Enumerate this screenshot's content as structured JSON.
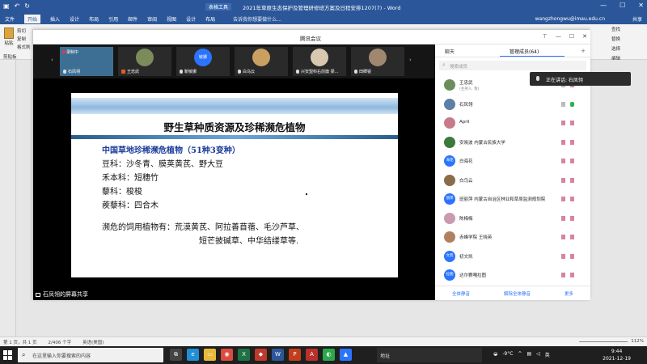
{
  "word": {
    "title_tools_tab": "表格工具",
    "doc_title": "2021年草原生态保护及管理研修班方案及日程安排1207(7) - Word",
    "tabs": [
      "文件",
      "开始",
      "插入",
      "设计",
      "布局",
      "引用",
      "邮件",
      "审阅",
      "视图",
      "设计",
      "布局"
    ],
    "active_tab": "开始",
    "tell_me": "告诉我你想要做什么...",
    "account": "wangzhongwu@imau.edu.cn",
    "share": "共享",
    "clipboard": {
      "paste": "粘贴",
      "cut": "剪切",
      "copy": "复制",
      "format": "格式刷",
      "group": "剪贴板"
    },
    "editing": {
      "find": "查找",
      "replace": "替换",
      "select": "选择",
      "group": "编辑"
    },
    "status": {
      "page": "第 1 页，共 1 页",
      "words": "2/406 个字",
      "lang": "英语(美国)",
      "zoom": "112%"
    }
  },
  "meeting": {
    "title": "腾讯会议",
    "recording_label": "录制中",
    "tiles": [
      {
        "name": "石凤翎",
        "mic": "on"
      },
      {
        "name": "王忠武",
        "mic": "off"
      },
      {
        "name": "靳敏娜",
        "mic": "on",
        "avatar": "敏娜"
      },
      {
        "name": "白乌云",
        "mic": "on"
      },
      {
        "name": "兴安盟科右前旗 梁...",
        "mic": "on"
      },
      {
        "name": "田卿锟",
        "mic": "on"
      }
    ],
    "share_label": "石凤翎的屏幕共享"
  },
  "slide": {
    "title": "野生草种质资源及珍稀濒危植物",
    "subtitle": "中国草地珍稀濒危植物（51种3变种）",
    "lines": [
      "豆科：沙冬青、膜荚黄芪、野大豆",
      "禾本科：短穗竹",
      "藜科：梭梭",
      "蒺藜科：四合木"
    ],
    "endangered_line1": "濒危的饲用植物有：荒漠黄芪、阿拉善苜蓿、毛沙芦草、",
    "endangered_line2": "短芒披碱草、中华结缕草等."
  },
  "panel": {
    "tab_chat": "聊天",
    "tab_members": "管理成员(64)",
    "search_placeholder": "搜索成员",
    "members": [
      {
        "name": "王忠武",
        "sub": "(主持人, 我)",
        "color": "#6b8e5a",
        "avatar": "",
        "cam": "on",
        "mic": "off"
      },
      {
        "name": "石凤翎",
        "sub": "",
        "color": "#5d7ea6",
        "avatar": "",
        "cam": "on",
        "mic": "on"
      },
      {
        "name": "April",
        "sub": "",
        "color": "#c77a8a",
        "avatar": "",
        "cam": "off",
        "mic": "off"
      },
      {
        "name": "安晓波 内蒙古民族大学",
        "sub": "",
        "color": "#3a7a3a",
        "avatar": "",
        "cam": "off",
        "mic": "off"
      },
      {
        "name": "白海花",
        "sub": "",
        "color": "#2b74ff",
        "avatar": "海花",
        "cam": "off",
        "mic": "off"
      },
      {
        "name": "白乌云",
        "sub": "",
        "color": "#8a6b4a",
        "avatar": "",
        "cam": "off",
        "mic": "off"
      },
      {
        "name": "班丽萍 内蒙古自治区林业和草原监测规划院",
        "sub": "",
        "color": "#2b74ff",
        "avatar": "丽萍",
        "cam": "off",
        "mic": "off"
      },
      {
        "name": "陈梅梅",
        "sub": "",
        "color": "#c99ab0",
        "avatar": "",
        "cam": "off",
        "mic": "off"
      },
      {
        "name": "赤峰学院 王晓英",
        "sub": "",
        "color": "#b08060",
        "avatar": "",
        "cam": "off",
        "mic": "off"
      },
      {
        "name": "初文凯",
        "sub": "",
        "color": "#2b74ff",
        "avatar": "文凯",
        "cam": "off",
        "mic": "off"
      },
      {
        "name": "达尔赛嘎拉图",
        "sub": "",
        "color": "#2b74ff",
        "avatar": "拉图",
        "cam": "off",
        "mic": "off"
      }
    ],
    "mute_all": "全体静音",
    "unmute_all": "解除全体静音",
    "more": "更多"
  },
  "speaking": {
    "label": "正在讲话: 石凤翎"
  },
  "taskbar": {
    "search_placeholder": "在这里输入你要搜索的内容",
    "address_label": "地址",
    "weather": "-9°C",
    "ime": "英",
    "time": "9:44",
    "date": "2021-12-19"
  }
}
